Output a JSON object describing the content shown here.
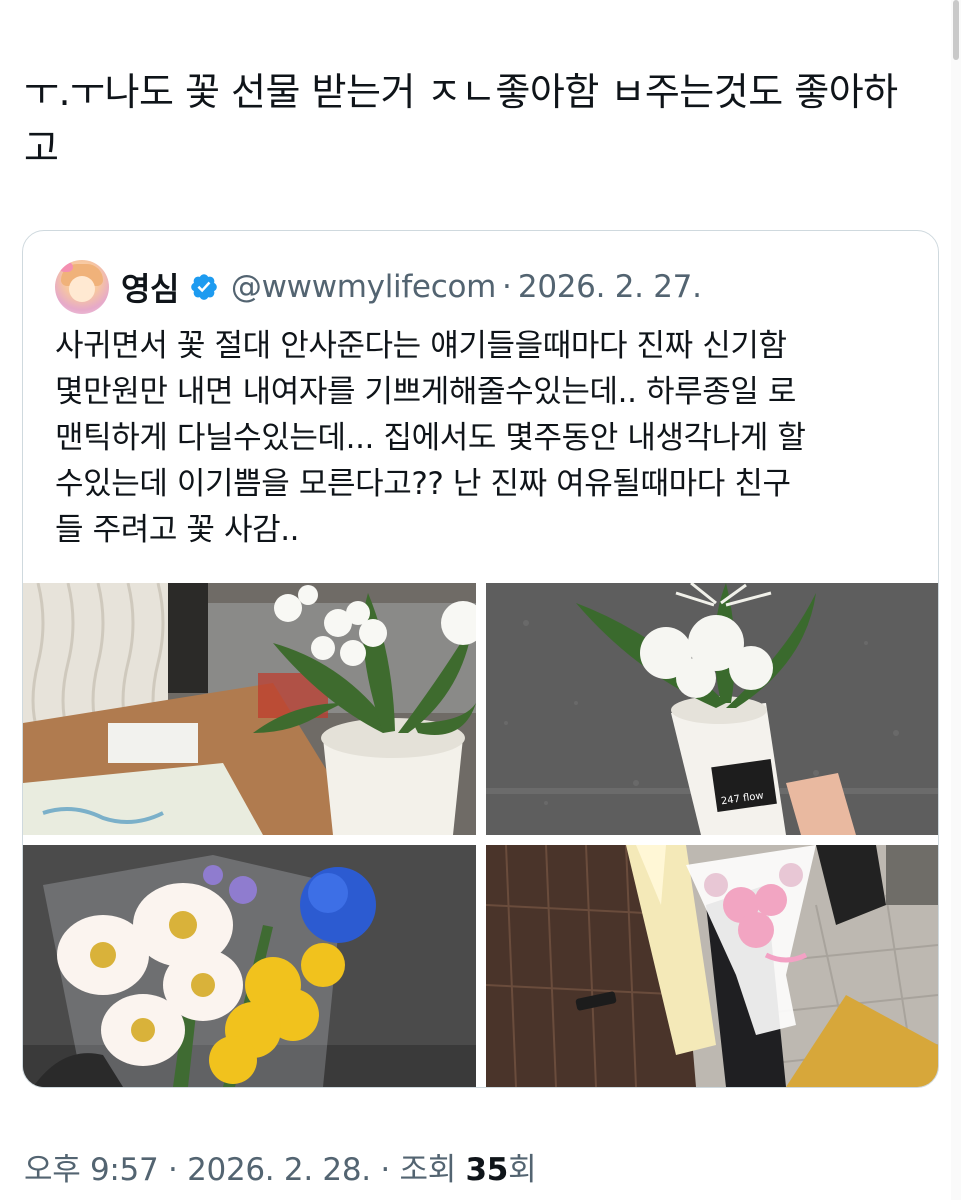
{
  "tweet": {
    "text_line1": "ㅜ.ㅜ나도 꽃 선물 받는거 ㅈㄴ좋아함 ㅂ주는것도 좋아하",
    "text_line2": "고",
    "time": "오후 9:57",
    "date": "2026. 2. 28.",
    "views_label": "조회",
    "views_count": "35",
    "views_unit": "회"
  },
  "quoted": {
    "display_name": "영심",
    "handle": "@wwwmylifecom",
    "date": "2026. 2. 27.",
    "lines": [
      "사귀면서 꽃 절대 안사준다는 얘기들을때마다 진짜 신기함",
      "몇만원만 내면 내여자를 기쁘게해줄수있는데.. 하루종일 로",
      "맨틱하게 다닐수있는데... 집에서도 몇주동안 내생각나게 할",
      "수있는데 이기쁨을 모른다고?? 난 진짜 여유될때마다 친구",
      "들 주려고 꽃 사감.."
    ],
    "photo_text": {
      "cup_brand": "247 flow"
    }
  },
  "colors": {
    "text": "#0f1419",
    "secondary": "#536471",
    "border": "#cfd9de",
    "verified": "#1d9bf0"
  },
  "icons": [
    "verified-badge-icon"
  ]
}
